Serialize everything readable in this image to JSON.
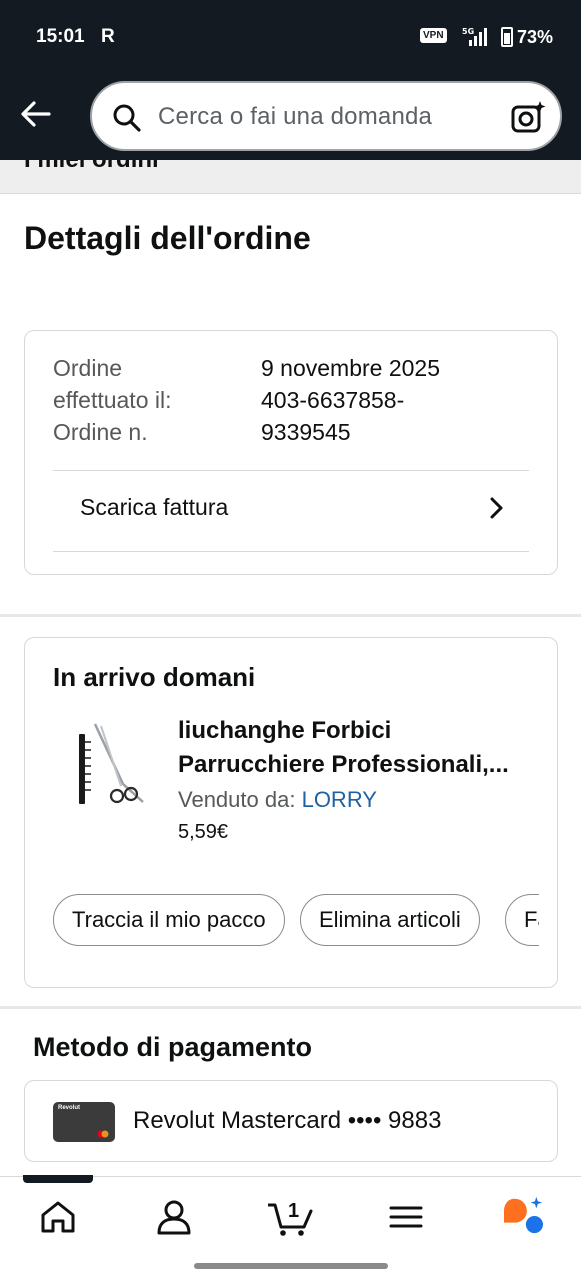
{
  "status_bar": {
    "time": "15:01",
    "app_letter": "R",
    "vpn": "VPN",
    "network": "5G",
    "battery": "73%"
  },
  "header": {
    "search_placeholder": "Cerca o fai una domanda"
  },
  "breadcrumb": {
    "cut_text": "I miei ordini"
  },
  "page_title": "Dettagli dell'ordine",
  "order_info": {
    "label_date": "Ordine effettuato il:",
    "label_date_line1": "Ordine",
    "label_date_line2": "effettuato il:",
    "date": "9 novembre 2025",
    "label_number": "Ordine n.",
    "number_line1": "403-6637858-",
    "number_line2": "9339545",
    "invoice_label": "Scarica fattura"
  },
  "shipment": {
    "heading": "In arrivo domani",
    "product_line1": "liuchanghe Forbici",
    "product_line2": "Parrucchiere Professionali,...",
    "seller_prefix": "Venduto da:",
    "seller_name": "LORRY",
    "price": "5,59€",
    "actions": [
      "Traccia il mio pacco",
      "Elimina articoli",
      "Fa"
    ]
  },
  "payment": {
    "heading": "Metodo di pagamento",
    "card_brand": "Revolut",
    "card_label": "Revolut Mastercard •••• 9883"
  },
  "bottom_nav": {
    "cart_count": "1",
    "items": [
      "home-icon",
      "account-icon",
      "cart-icon",
      "menu-icon",
      "rufus-icon"
    ]
  },
  "colors": {
    "header_bg": "#131a22",
    "link": "#2162a1",
    "rufus_orange": "#ff6f20",
    "rufus_blue": "#1a73e8"
  }
}
